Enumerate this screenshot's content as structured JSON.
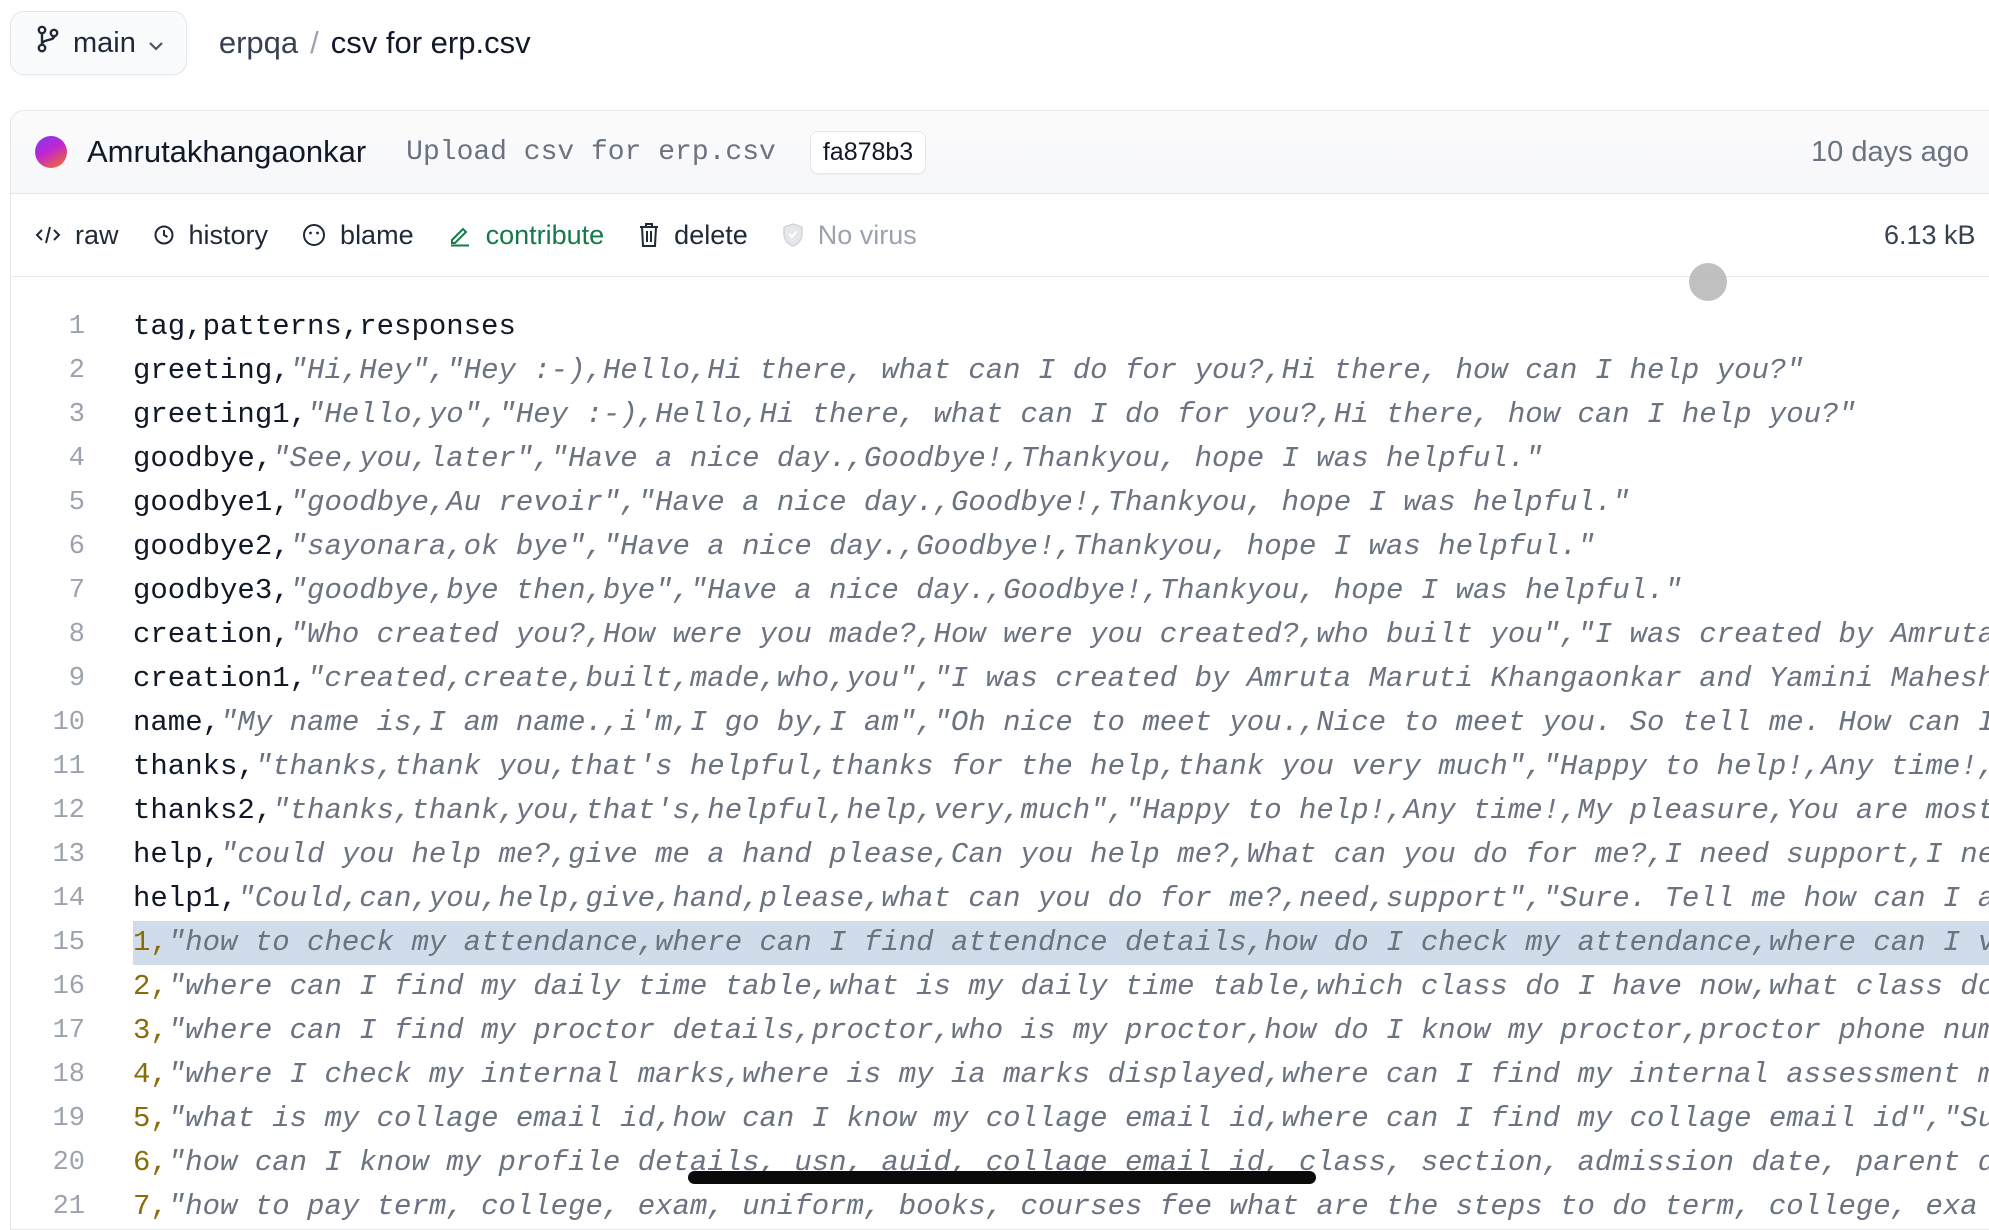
{
  "branch": {
    "name": "main"
  },
  "breadcrumb": {
    "repo": "erpqa",
    "separator": "/",
    "file": "csv for erp.csv"
  },
  "commit": {
    "author": "Amrutakhangaonkar",
    "message": "Upload csv for erp.csv",
    "sha": "fa878b3",
    "time": "10 days ago"
  },
  "actions": {
    "raw": "raw",
    "history": "history",
    "blame": "blame",
    "contribute": "contribute",
    "delete": "delete",
    "novirus": "No virus",
    "filesize": "6.13 kB"
  },
  "lines": [
    {
      "n": "1",
      "tag": "tag,patterns,responses",
      "q": "",
      "numeric": false
    },
    {
      "n": "2",
      "tag": "greeting,",
      "q": "\"Hi,Hey\",\"Hey :-),Hello,Hi there, what can I do for you?,Hi there, how can I help you?\"",
      "numeric": false
    },
    {
      "n": "3",
      "tag": "greeting1,",
      "q": "\"Hello,yo\",\"Hey :-),Hello,Hi there, what can I do for you?,Hi there, how can I help you?\"",
      "numeric": false
    },
    {
      "n": "4",
      "tag": "goodbye,",
      "q": "\"See,you,later\",\"Have a nice day.,Goodbye!,Thankyou, hope I was helpful.\"",
      "numeric": false
    },
    {
      "n": "5",
      "tag": "goodbye1,",
      "q": "\"goodbye,Au revoir\",\"Have a nice day.,Goodbye!,Thankyou, hope I was helpful.\"",
      "numeric": false
    },
    {
      "n": "6",
      "tag": "goodbye2,",
      "q": "\"sayonara,ok bye\",\"Have a nice day.,Goodbye!,Thankyou, hope I was helpful.\"",
      "numeric": false
    },
    {
      "n": "7",
      "tag": "goodbye3,",
      "q": "\"goodbye,bye then,bye\",\"Have a nice day.,Goodbye!,Thankyou, hope I was helpful.\"",
      "numeric": false
    },
    {
      "n": "8",
      "tag": "creation,",
      "q": "\"Who created you?,How were you made?,How were you created?,who built you\",\"I was created by Amruta Ma",
      "numeric": false
    },
    {
      "n": "9",
      "tag": "creation1,",
      "q": "\"created,create,built,made,who,you\",\"I was created by Amruta Maruti Khangaonkar and Yamini Mahesh, A",
      "numeric": false
    },
    {
      "n": "10",
      "tag": "name,",
      "q": "\"My name is,I am name.,i'm,I go by,I am\",\"Oh nice to meet you.,Nice to meet you. So tell me. How can I he",
      "numeric": false
    },
    {
      "n": "11",
      "tag": "thanks,",
      "q": "\"thanks,thank you,that's helpful,thanks for the help,thank you very much\",\"Happy to help!,Any time!,My p",
      "numeric": false
    },
    {
      "n": "12",
      "tag": "thanks2,",
      "q": "\"thanks,thank,you,that's,helpful,help,very,much\",\"Happy to help!,Any time!,My pleasure,You are most we",
      "numeric": false
    },
    {
      "n": "13",
      "tag": "help,",
      "q": "\"could you help me?,give me a hand please,Can you help me?,What can you do for me?,I need support,I need h",
      "numeric": false
    },
    {
      "n": "14",
      "tag": "help1,",
      "q": "\"Could,can,you,help,give,hand,please,what can you do for me?,need,support\",\"Sure. Tell me how can I assi",
      "numeric": false
    },
    {
      "n": "15",
      "tag": "1,",
      "q": "\"how to check my attendance,where can I find attendnce details,how do I check my attendance,where can I view",
      "numeric": true,
      "highlight": true
    },
    {
      "n": "16",
      "tag": "2,",
      "q": "\"where can I find my daily time table,what is my daily time table,which class do I have now,what class do I h",
      "numeric": true
    },
    {
      "n": "17",
      "tag": "3,",
      "q": "\"where can I find my proctor details,proctor,who is my proctor,how do I know my proctor,proctor phone number,",
      "numeric": true
    },
    {
      "n": "18",
      "tag": "4,",
      "q": "\"where I check my internal marks,where is my ia marks displayed,where can I find my internal assessment marks",
      "numeric": true
    },
    {
      "n": "19",
      "tag": "5,",
      "q": "\"what is my collage email id,how can I know my collage email id,where can I find my collage email id\",\"Sure,",
      "numeric": true
    },
    {
      "n": "20",
      "tag": "6,",
      "q": "\"how can I know my profile details, usn, auid, collage email id, class, section, admission date, parent detai",
      "numeric": true
    },
    {
      "n": "21",
      "tag": "7,",
      "q": "\"how to pay term, college, exam, uniform, books, courses fee what are the steps to do term, college, exa",
      "numeric": true
    }
  ]
}
